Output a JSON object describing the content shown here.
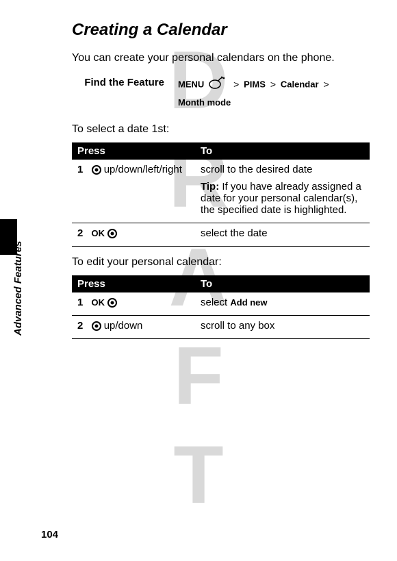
{
  "watermark": "DRAFT",
  "sidebar_label": "Advanced Features",
  "page_number": "104",
  "title": "Creating a Calendar",
  "intro": "You can create your personal calendars on the phone.",
  "find_feature": {
    "label": "Find the Feature",
    "menu": "MENU",
    "sep1": ">",
    "pims": "PIMS",
    "sep2": ">",
    "calendar": "Calendar",
    "sep3": ">",
    "month_mode": "Month mode"
  },
  "section1_text": "To select a date 1st:",
  "table_headers": {
    "press": "Press",
    "to": "To"
  },
  "table1": {
    "row1": {
      "num": "1",
      "press": "up/down/left/right",
      "to_main": "scroll to the desired date",
      "tip_label": "Tip:",
      "tip_text": " If you have already assigned a date for your personal calendar(s), the specified date is highlighted."
    },
    "row2": {
      "num": "2",
      "ok": "OK",
      "to": "select the date"
    }
  },
  "section2_text": "To edit your personal calendar:",
  "table2": {
    "row1": {
      "num": "1",
      "ok": "OK",
      "to_prefix": "select ",
      "addnew": "Add new"
    },
    "row2": {
      "num": "2",
      "press": "up/down",
      "to": "scroll to any box"
    }
  }
}
